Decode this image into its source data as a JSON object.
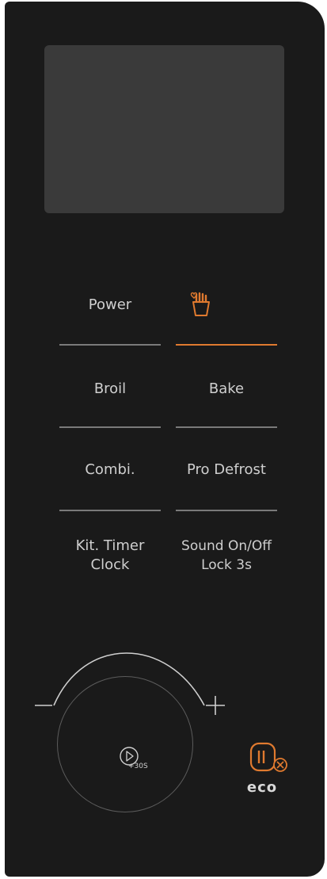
{
  "buttons": {
    "power": "Power",
    "broil": "Broil",
    "bake": "Bake",
    "combi": "Combi.",
    "pro_defrost": "Pro Defrost",
    "kit_timer_line1": "Kit. Timer",
    "kit_timer_line2": "Clock",
    "sound_line1": "Sound On/Off",
    "sound_line2": "Lock 3s"
  },
  "dial": {
    "minus": "—",
    "plus": "+",
    "start_label": "+30S"
  },
  "eco": {
    "label": "eco"
  },
  "icons": {
    "fries": "fries-icon",
    "play": "play-icon",
    "eco": "eco-icon"
  },
  "colors": {
    "accent": "#e07a2f",
    "panel": "#1a1a1a",
    "display": "#3a3a3a"
  }
}
